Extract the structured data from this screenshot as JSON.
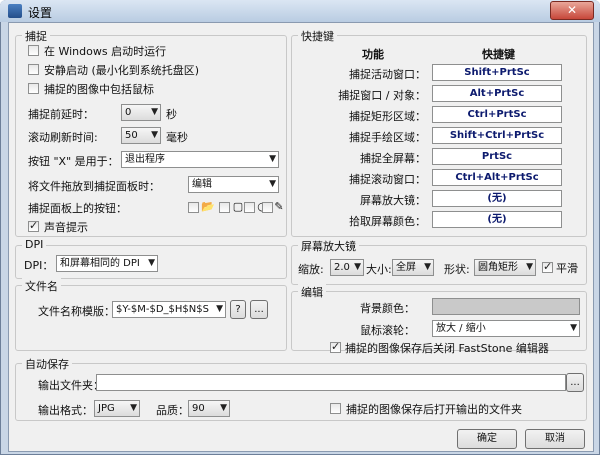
{
  "window": {
    "title": "设置",
    "close": "✕"
  },
  "capture": {
    "group": "捕捉",
    "run_at_startup": "在 Windows 启动时运行",
    "quiet_start": "安静启动 (最小化到系统托盘区)",
    "include_cursor": "捕捉的图像中包括鼠标",
    "delay_label": "捕捉前延时：",
    "delay_value": "0",
    "delay_unit": "秒",
    "scroll_label": "滚动刷新时间:",
    "scroll_value": "50",
    "scroll_unit": "毫秒",
    "x_button_label": "按钮 \"X\" 是用于：",
    "x_button_value": "退出程序",
    "drag_label": "将文件拖放到捕捉面板时：",
    "drag_value": "编辑",
    "panel_buttons_label": "捕捉面板上的按钮：",
    "sound": "声音提示"
  },
  "hotkeys": {
    "group": "快捷键",
    "col_function": "功能",
    "col_hotkey": "快捷键",
    "rows": [
      {
        "label": "捕捉活动窗口：",
        "key": "Shift+PrtSc"
      },
      {
        "label": "捕捉窗口 / 对象：",
        "key": "Alt+PrtSc"
      },
      {
        "label": "捕捉矩形区域：",
        "key": "Ctrl+PrtSc"
      },
      {
        "label": "捕捉手绘区域：",
        "key": "Shift+Ctrl+PrtSc"
      },
      {
        "label": "捕捉全屏幕：",
        "key": "PrtSc"
      },
      {
        "label": "捕捉滚动窗口：",
        "key": "Ctrl+Alt+PrtSc"
      },
      {
        "label": "屏幕放大镜：",
        "key": "(无)"
      },
      {
        "label": "拾取屏幕颜色：",
        "key": "(无)"
      }
    ]
  },
  "dpi": {
    "group": "DPI",
    "label": "DPI：",
    "value": "和屏幕相同的 DPI"
  },
  "magnifier": {
    "group": "屏幕放大镜",
    "zoom_label": "缩放:",
    "zoom_value": "2.0",
    "size_label": "大小:",
    "size_value": "全屏",
    "shape_label": "形状:",
    "shape_value": "圆角矩形",
    "smooth": "平滑"
  },
  "filename": {
    "group": "文件名",
    "label": "文件名称模版：",
    "value": "$Y-$M-$D_$H$N$S",
    "help": "?",
    "browse": "..."
  },
  "edit": {
    "group": "编辑",
    "bg_label": "背景颜色：",
    "wheel_label": "鼠标滚轮：",
    "wheel_value": "放大 / 缩小",
    "after_close": "捕捉的图像保存后关闭 FastStone 编辑器"
  },
  "autosave": {
    "group": "自动保存",
    "output_label": "输出文件夹：",
    "output_value": "",
    "browse": "...",
    "format_label": "输出格式：",
    "format_value": "JPG",
    "quality_label": "品质：",
    "quality_value": "90",
    "open_folder": "捕捉的图像保存后打开输出的文件夹"
  },
  "footer": {
    "ok": "确定",
    "cancel": "取消"
  }
}
